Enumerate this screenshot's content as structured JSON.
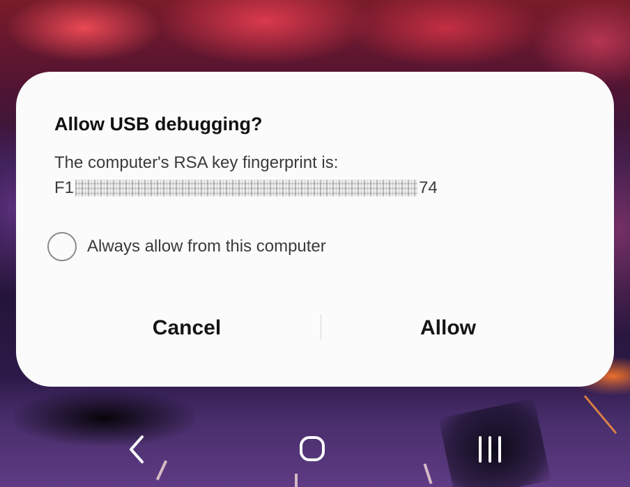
{
  "dialog": {
    "title": "Allow USB debugging?",
    "message": "The computer's RSA key fingerprint is:",
    "fingerprint_prefix": "F1",
    "fingerprint_suffix": "74",
    "always_allow_label": "Always allow from this computer",
    "always_allow_checked": false,
    "cancel_label": "Cancel",
    "allow_label": "Allow"
  },
  "navbar": {
    "back_icon": "chevron-left-icon",
    "home_icon": "rounded-square-icon",
    "recents_icon": "three-bars-icon",
    "icon_color": "#ffffff"
  },
  "colors": {
    "dialog_background": "#fbfbfb",
    "title_text": "#111111",
    "body_text": "#3a3a3a",
    "radio_border": "#8a8a8a"
  }
}
